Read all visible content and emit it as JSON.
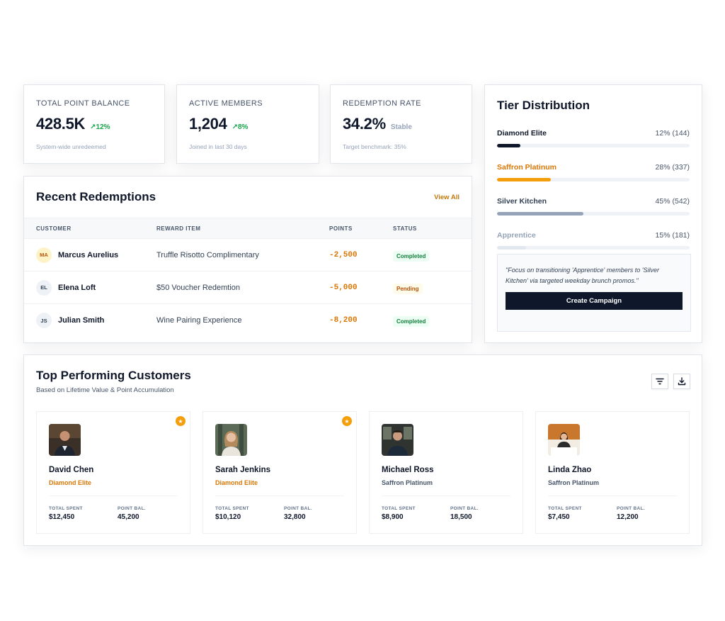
{
  "stats": [
    {
      "label": "TOTAL POINT BALANCE",
      "value": "428.5K",
      "trend": "12%",
      "trend_type": "up",
      "sub": "System-wide unredeemed"
    },
    {
      "label": "ACTIVE MEMBERS",
      "value": "1,204",
      "trend": "8%",
      "trend_type": "up",
      "sub": "Joined in last 30 days"
    },
    {
      "label": "REDEMPTION RATE",
      "value": "34.2%",
      "trend": "Stable",
      "trend_type": "neutral",
      "sub": "Target benchmark: 35%"
    }
  ],
  "recent": {
    "title": "Recent Redemptions",
    "view_all": "View All",
    "columns": [
      "CUSTOMER",
      "REWARD ITEM",
      "POINTS",
      "STATUS"
    ],
    "rows": [
      {
        "initials": "MA",
        "name": "Marcus Aurelius",
        "reward": "Truffle Risotto Complimentary",
        "points": "-2,500",
        "status": "Completed"
      },
      {
        "initials": "EL",
        "name": "Elena Loft",
        "reward": "$50 Voucher Redemtion",
        "points": "-5,000",
        "status": "Pending"
      },
      {
        "initials": "JS",
        "name": "Julian Smith",
        "reward": "Wine Pairing Experience",
        "points": "-8,200",
        "status": "Completed"
      }
    ]
  },
  "tier": {
    "title": "Tier Distribution",
    "items": [
      {
        "name": "Diamond Elite",
        "value": "12% (144)",
        "percent": 12,
        "color": "#0f172a",
        "label_color": "#0f172a"
      },
      {
        "name": "Saffron Platinum",
        "value": "28% (337)",
        "percent": 28,
        "color": "#f59e0b",
        "label_color": "#d97706"
      },
      {
        "name": "Silver Kitchen",
        "value": "45% (542)",
        "percent": 45,
        "color": "#94a3b8",
        "label_color": "#334155"
      },
      {
        "name": "Apprentice",
        "value": "15% (181)",
        "percent": 15,
        "color": "#e2e8f0",
        "label_color": "#94a3b8"
      }
    ],
    "note": "\"Focus on transitioning 'Apprentice' members to 'Silver Kitchen' via targeted weekday brunch promos.\"",
    "cta": "Create Campaign"
  },
  "top": {
    "title": "Top Performing Customers",
    "subtitle": "Based on Lifetime Value & Point Accumulation",
    "filter_icon": "filter-icon",
    "download_icon": "download-icon",
    "spent_label": "TOTAL SPENT",
    "points_label": "POINT BAL.",
    "customers": [
      {
        "name": "David Chen",
        "tier": "Diamond Elite",
        "tier_color": "#d97706",
        "spent": "$12,450",
        "points": "45,200",
        "starred": true
      },
      {
        "name": "Sarah Jenkins",
        "tier": "Diamond Elite",
        "tier_color": "#d97706",
        "spent": "$10,120",
        "points": "32,800",
        "starred": true
      },
      {
        "name": "Michael Ross",
        "tier": "Saffron Platinum",
        "tier_color": "#475569",
        "spent": "$8,900",
        "points": "18,500",
        "starred": false
      },
      {
        "name": "Linda Zhao",
        "tier": "Saffron Platinum",
        "tier_color": "#475569",
        "spent": "$7,450",
        "points": "12,200",
        "starred": false
      }
    ]
  }
}
